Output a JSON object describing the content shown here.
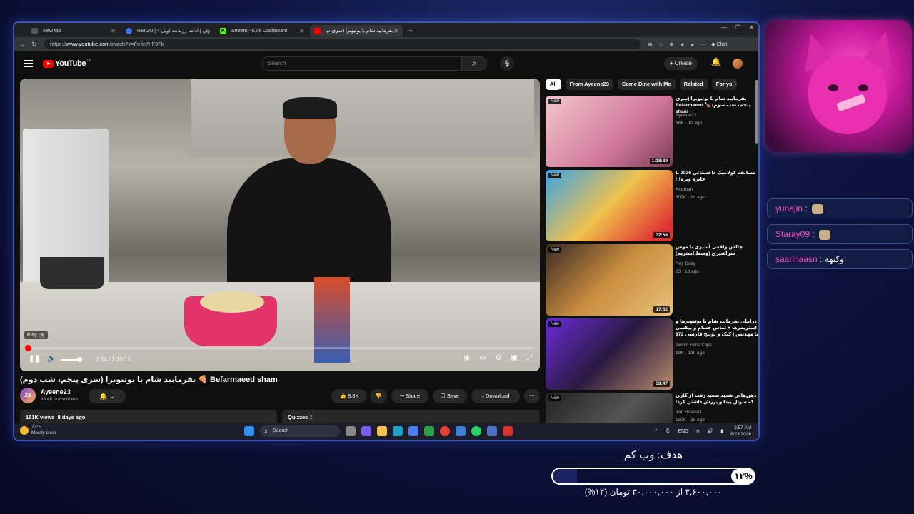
{
  "browser": {
    "tabs": [
      {
        "label": "New tab",
        "active": false
      },
      {
        "label": "REIGN | رین | ادامه رزیدنت اویل 4",
        "active": false
      },
      {
        "label": "Stream - Kick Dashboard",
        "active": false
      },
      {
        "label": "بفرمایید شام با یوتیوبرا (سری پ",
        "active": true
      }
    ],
    "url_prefix": "https://",
    "url_host": "www.youtube.com",
    "url_path": "/watch?v=Fmle7nF9Fk",
    "chat_label": "Chat"
  },
  "youtube": {
    "logo_text": "YouTube",
    "country_code": "DE",
    "search_placeholder": "Search",
    "create_label": "Create",
    "player": {
      "tooltip": "Play",
      "tooltip_key": "K",
      "time": "0:24 / 1:30:12",
      "progress_fraction": 0.0044,
      "volume_fraction": 0.9
    },
    "video_title": "بفرمایید شام با یوتیوبرا (سری پنجم، شب دوم) 🍕 Befarmaeed sham",
    "channel": {
      "name": "Ayeene23",
      "subscribers": "93.4K subscribers"
    },
    "actions": {
      "likes": "8.8K",
      "share": "Share",
      "save": "Save",
      "download": "Download"
    },
    "description": {
      "views": "161K views",
      "age": "8 days ago"
    },
    "quizzes": {
      "label": "Quizzes",
      "count": "2"
    },
    "chips": [
      "All",
      "From Ayeene23",
      "Come Dine with Me",
      "Related",
      "For yo"
    ],
    "recommendations": [
      {
        "title": "بفرمایید شام با یوتیوبرا (سری پنجم، شب سوم) 🍗 Befarmaeed sham",
        "channel": "Ayeene23",
        "meta": "96K · 1d ago",
        "duration": "1:18:39",
        "badge": "New"
      },
      {
        "title": "مسابقه کولامیک داغستانی 2026 با جایزه ویژه!!!",
        "channel": "Kouman",
        "meta": "807K · 1d ago",
        "duration": "32:56",
        "badge": "New"
      },
      {
        "title": "چالش واقعی آشپزی با موش سرآشپزی (وسط استریم)",
        "channel": "Rey Daily",
        "meta": "23 · 1d ago",
        "duration": "17:52",
        "badge": "New"
      },
      {
        "title": "درامای بفرمایید شام با یوتیوبرها و استریمرها ● تماس حسام و پیکسی با مهدیس | کیک و توییچ فارسی 872",
        "channel": "Twitch Farsi Clips",
        "meta": "18K · 13h ago",
        "duration": "58:47",
        "badge": "New"
      },
      {
        "title": "ذهن‌هایی شدید سعید رفت از کاری که سوال پیدا و پررش داشتن کرد!",
        "channel": "Iran Havashi",
        "meta": "137K · 3d ago",
        "duration": "",
        "badge": "New"
      }
    ]
  },
  "taskbar": {
    "temp": "77°F",
    "weather": "Mostly clear",
    "search": "Search",
    "lang": "ENG",
    "time": "2:57 AM",
    "date": "8/23/2026"
  },
  "chat": [
    {
      "user": "yunajin",
      "text": ""
    },
    {
      "user": "Staray09",
      "text": ""
    },
    {
      "user": "saarinaasn",
      "text": "اوکیهه"
    }
  ],
  "goal": {
    "title": "هدف: وب کم",
    "percent_label": "۱۲%",
    "fraction": 0.12,
    "subtitle": "۳,۶۰۰,۰۰۰ از ۳۰,۰۰۰,۰۰۰ تومان (۱۲%)"
  },
  "colors": {
    "accent": "#ff0000",
    "chat_user": "#ff4fb8",
    "frame": "#3b57b8"
  }
}
